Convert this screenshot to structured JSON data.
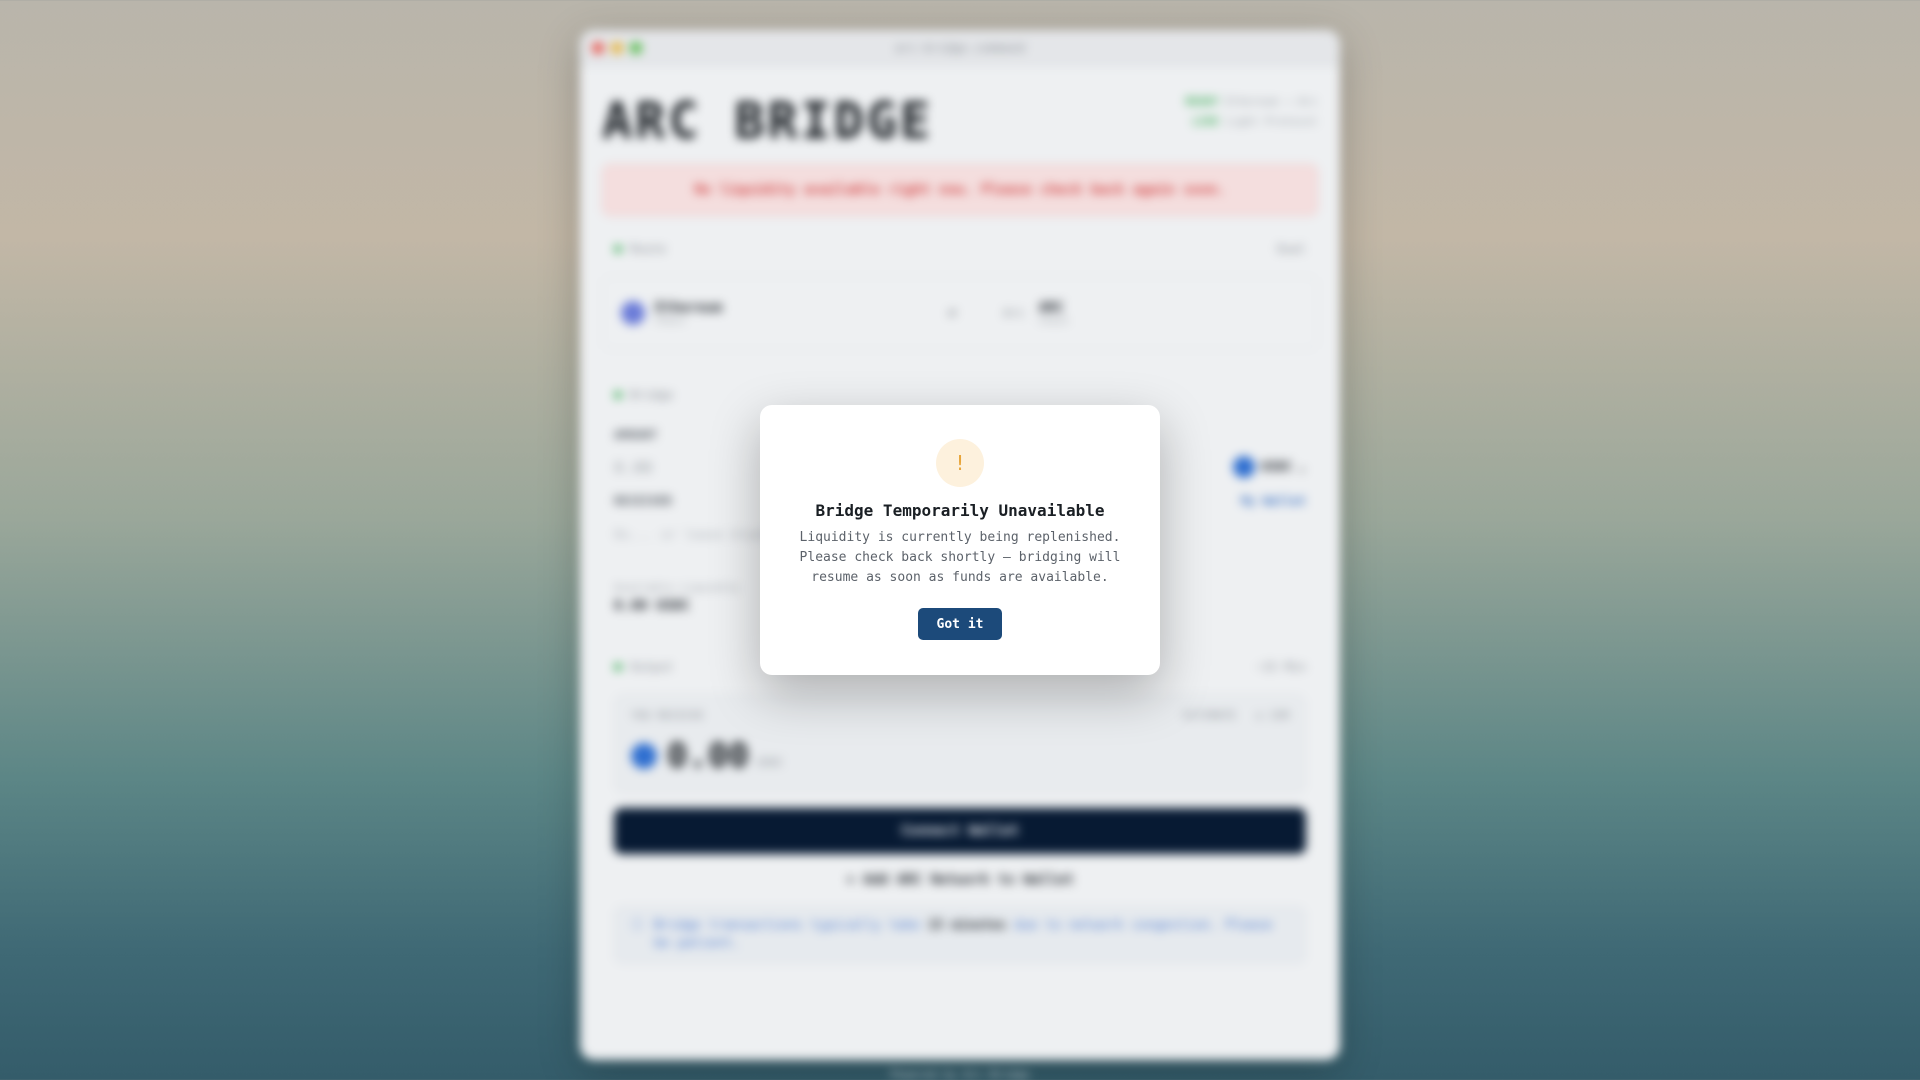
{
  "window": {
    "title": "arc-bridge.command"
  },
  "header": {
    "logo": "ARC BRIDGE",
    "status_line_1_tag": "READY",
    "status_line_1_text": "Ethereum → Arc",
    "status_line_2_tag": "LIVE",
    "status_line_2_text": "Light Protocol"
  },
  "alert": {
    "text": "No liquidity available right now. Please check back again soon."
  },
  "route": {
    "label": "Route",
    "right_label": "Dual",
    "from_chain": "Ethereum",
    "from_sub": "Chain",
    "swap_symbol": "⇄",
    "to_prefix": "Arc",
    "to_chain": "ARC",
    "to_sub": "Chain"
  },
  "bridge": {
    "label": "Bridge",
    "amount_label": "AMOUNT",
    "amount_value": "0.00",
    "token": "USDC",
    "recipient_label": "RECEIVER",
    "recipient_link": "My Wallet",
    "recipient_placeholder": "0x... or leave blank",
    "liquidity_label": "Available Liquidity",
    "liquidity_value": "0.00 USDC"
  },
  "output": {
    "label": "Output",
    "right_label": "~15 Min",
    "receive_label": "YOU RECEIVE",
    "receive_badge_1": "ESTIMATE",
    "receive_badge_2": "◷ 15M",
    "receive_amount": "0.00",
    "receive_unit": "USDC"
  },
  "actions": {
    "connect_label": "Connect Wallet",
    "add_network_label": "+ Add ARC Network to Wallet"
  },
  "info": {
    "icon": "ⓘ",
    "text_1": "Bridge transactions typically take ",
    "text_bold": "15 minutes",
    "text_2": " due to network congestion. Please be patient."
  },
  "footer": {
    "text": "Powered by Arc Bridge"
  },
  "modal": {
    "icon": "!",
    "title": "Bridge Temporarily Unavailable",
    "body": "Liquidity is currently being replenished. Please check back shortly — bridging will resume as soon as funds are available.",
    "button_label": "Got it"
  },
  "colors": {
    "accent": "#1c4a7a",
    "alert_red": "#d44b4b",
    "warning_amber": "#e8a53a",
    "status_green": "#3fae5a"
  }
}
